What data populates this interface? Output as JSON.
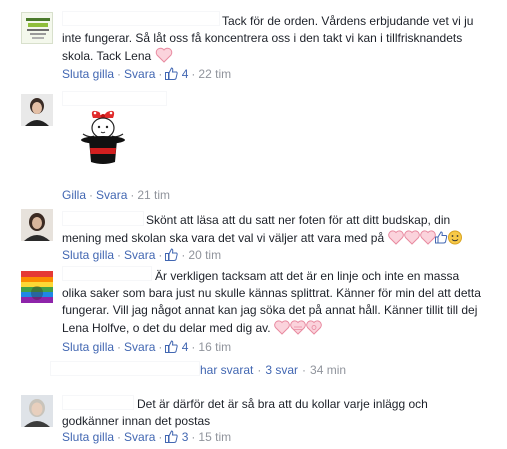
{
  "comments": [
    {
      "text_lines": [
        "Tack för de orden. Vårdens erbjudande vet vi ju",
        "inte fungerar. Så låt oss få koncentrera oss i den takt vi kan i tillfrisknandets",
        "skola. Tack Lena"
      ],
      "unlike_label": "Sluta gilla",
      "reply_label": "Svara",
      "like_count": "4",
      "time": "22 tim"
    },
    {
      "sticker": "magician-hat-sticker",
      "like_label": "Gilla",
      "reply_label": "Svara",
      "time": "21 tim"
    },
    {
      "text_lines": [
        "Skönt att läsa att du satt ner foten för att ditt budskap, din",
        "mening med skolan ska vara det val vi väljer att vara med på"
      ],
      "unlike_label": "Sluta gilla",
      "reply_label": "Svara",
      "time": "20 tim"
    },
    {
      "text_lines": [
        "Är verkligen tacksam att det är en linje och inte en massa",
        "olika saker som bara just nu skulle kännas splittrat. Känner för min del att detta",
        "fungerar. Vill jag något annat kan jag söka det på annat håll. Känner tillit till dej",
        "Lena Holfve, o det du delar med dig av."
      ],
      "unlike_label": "Sluta gilla",
      "reply_label": "Svara",
      "like_count": "4",
      "time": "16 tim"
    },
    {
      "text_lines": [
        "Det är därför det är så bra att du kollar varje inlägg och",
        "godkänner innan det postas"
      ],
      "unlike_label": "Sluta gilla",
      "reply_label": "Svara",
      "like_count": "3",
      "time": "15 tim"
    }
  ],
  "replies": {
    "label": "har svarat",
    "count_label": "3 svar",
    "time": "34 min"
  },
  "colors": {
    "link": "#4267b2",
    "meta": "#90949c",
    "text": "#1d2129",
    "heart": "#f5b7c4"
  }
}
